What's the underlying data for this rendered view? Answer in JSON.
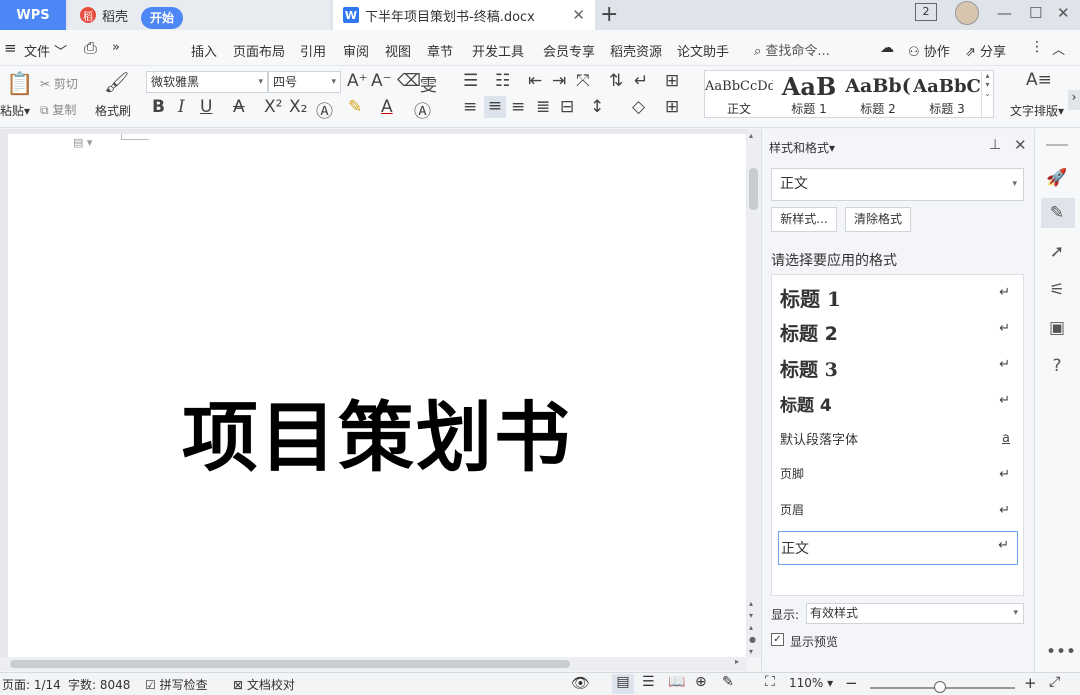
{
  "tabs": {
    "wps": "WPS",
    "daoke": "稻壳",
    "doc": "下半年项目策划书-终稿.docx",
    "window_count": "2"
  },
  "menu": {
    "file": "文件",
    "items": [
      "开始",
      "插入",
      "页面布局",
      "引用",
      "审阅",
      "视图",
      "章节",
      "开发工具",
      "会员专享",
      "稻壳资源",
      "论文助手"
    ],
    "search": "查找命令...",
    "collab": "协作",
    "share": "分享"
  },
  "ribbon": {
    "paste": "粘贴",
    "cut": "剪切",
    "copy": "复制",
    "format_painter": "格式刷",
    "font_name": "微软雅黑",
    "font_size": "四号",
    "styles": [
      {
        "preview": "AaBbCcDd",
        "label": "正文"
      },
      {
        "preview": "AaB",
        "label": "标题 1"
      },
      {
        "preview": "AaBb(",
        "label": "标题 2"
      },
      {
        "preview": "AaBbC",
        "label": "标题 3"
      }
    ],
    "text_layout": "文字排版"
  },
  "document": {
    "title": "项目策划书"
  },
  "panel": {
    "header": "样式和格式",
    "current_style": "正文",
    "new_style": "新样式...",
    "clear_format": "清除格式",
    "prompt": "请选择要应用的格式",
    "styles": [
      {
        "name": "标题 1",
        "mark": "↵"
      },
      {
        "name": "标题 2",
        "mark": "↵"
      },
      {
        "name": "标题 3",
        "mark": "↵"
      },
      {
        "name": "标题 4",
        "mark": "↵"
      },
      {
        "name": "默认段落字体",
        "mark": "a"
      },
      {
        "name": "页脚",
        "mark": "↵"
      },
      {
        "name": "页眉",
        "mark": "↵"
      },
      {
        "name": "正文",
        "mark": "↵"
      }
    ],
    "display_label": "显示:",
    "display_value": "有效样式",
    "show_preview": "显示预览",
    "show_preview_checked": true
  },
  "status": {
    "page": "页面: 1/14",
    "word_count": "字数: 8048",
    "spell_check": "拼写检查",
    "doc_proof": "文档校对",
    "zoom": "110%",
    "zoom_level_fraction": 0.48
  },
  "colors": {
    "accent": "#4c87f5"
  }
}
